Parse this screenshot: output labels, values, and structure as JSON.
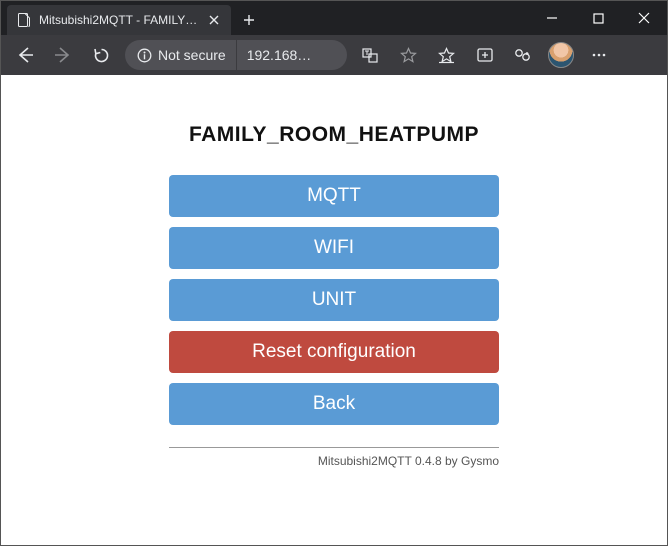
{
  "browser": {
    "tab_title": "Mitsubishi2MQTT - FAMILY_ROOM_HEATPUMP",
    "security_label": "Not secure",
    "url_display": "192.168…"
  },
  "page": {
    "heading": "FAMILY_ROOM_HEATPUMP",
    "buttons": {
      "mqtt": "MQTT",
      "wifi": "WIFI",
      "unit": "UNIT",
      "reset": "Reset configuration",
      "back": "Back"
    },
    "footer": "Mitsubishi2MQTT 0.4.8 by Gysmo"
  }
}
